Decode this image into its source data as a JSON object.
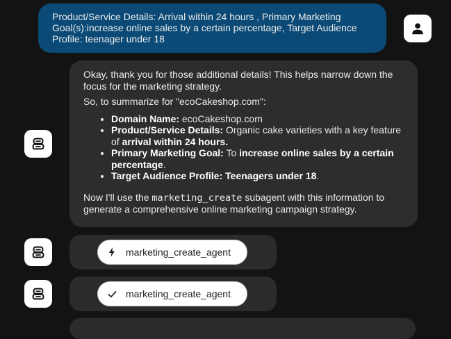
{
  "user_message": {
    "line1": "Product/Service Details: Arrival within 24 hours , Primary Marketing",
    "line2": "Goal(s):increase online sales by a certain percentage, Target Audience",
    "line3": "Profile: teenager under 18"
  },
  "assistant_message": {
    "intro": "Okay, thank you for those additional details! This helps narrow down the focus for the marketing strategy.",
    "summary_lead": "So, to summarize for \"ecoCakeshop.com\":",
    "items": [
      {
        "label": "Domain Name:",
        "text": " ecoCakeshop.com"
      },
      {
        "label": "Product/Service Details:",
        "text": " Organic cake varieties with a key feature of ",
        "bold_tail": "arrival within 24 hours",
        "end": "."
      },
      {
        "label": "Primary Marketing Goal:",
        "text": " To ",
        "bold_tail": "increase online sales by a certain percentage",
        "end": "."
      },
      {
        "label": "Target Audience Profile:",
        "text": " ",
        "bold_tail": "Teenagers under 18",
        "end": "."
      }
    ],
    "outro_pre": "Now I'll use the ",
    "outro_code": "marketing_create",
    "outro_post": " subagent with this information to generate a comprehensive online marketing campaign strategy."
  },
  "agent_calls": [
    {
      "label": "marketing_create_agent",
      "icon": "lightning-icon",
      "status": "running"
    },
    {
      "label": "marketing_create_agent",
      "icon": "checkmark-icon",
      "status": "done"
    }
  ],
  "colors": {
    "background": "#131313",
    "user_bubble": "#0b4a76",
    "assistant_bubble": "#2d2d2d",
    "avatar": "#ffffff"
  }
}
